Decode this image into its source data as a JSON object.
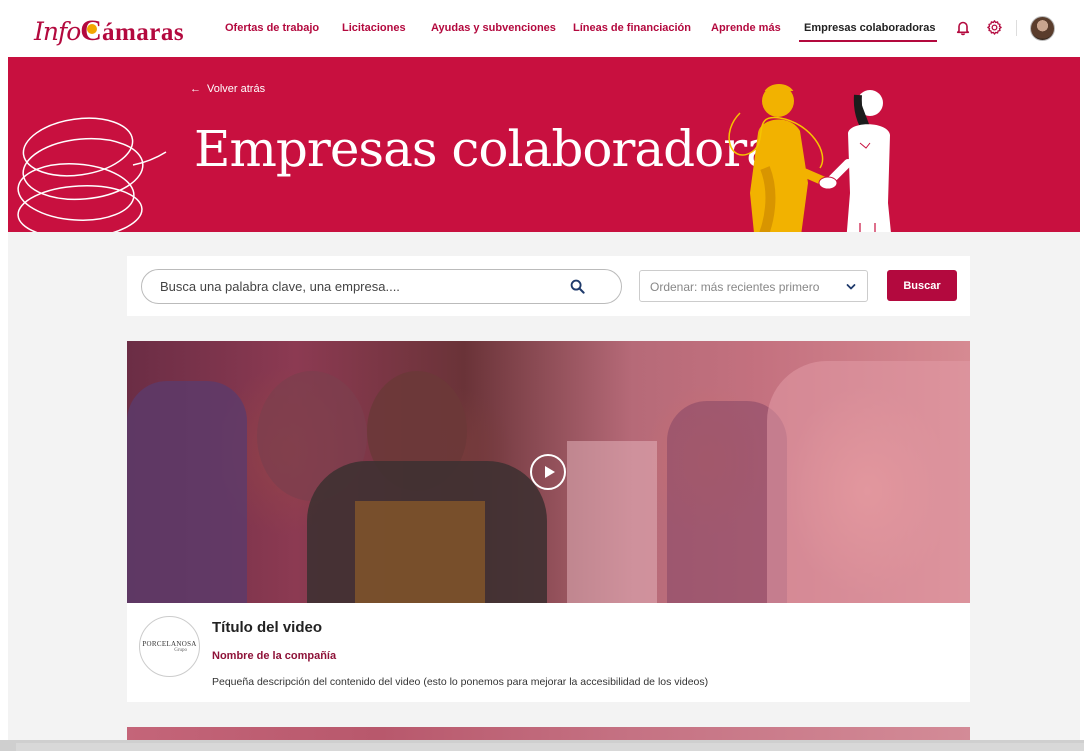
{
  "header": {
    "logo": {
      "part1": "Info",
      "part2": "C",
      "part3": "ámaras"
    },
    "nav": [
      {
        "label": "Ofertas de trabajo",
        "active": false
      },
      {
        "label": "Licitaciones",
        "active": false
      },
      {
        "label": "Ayudas y subvenciones",
        "active": false
      },
      {
        "label": "Líneas de financiación",
        "active": false
      },
      {
        "label": "Aprende más",
        "active": false
      },
      {
        "label": "Empresas colaboradoras",
        "active": true
      }
    ],
    "icons": [
      "bell-icon",
      "gear-icon",
      "avatar"
    ]
  },
  "hero": {
    "back_label": "Volver atrás",
    "title": "Empresas colaboradoras"
  },
  "search": {
    "placeholder": "Busca una palabra clave, una empresa....",
    "sort_value": "Ordenar: más recientes primero",
    "button_label": "Buscar"
  },
  "video": {
    "title": "Título del video",
    "company": "Nombre de la compañía",
    "description": "Pequeña descripción del contenido del video (esto lo ponemos para mejorar la accesibilidad de los videos)",
    "logo_line1": "PORCELANOSA",
    "logo_line2": "Grupo"
  },
  "colors": {
    "brand": "#b3093e",
    "hero_bg": "#c8103f",
    "accent_yellow": "#f2a500"
  }
}
